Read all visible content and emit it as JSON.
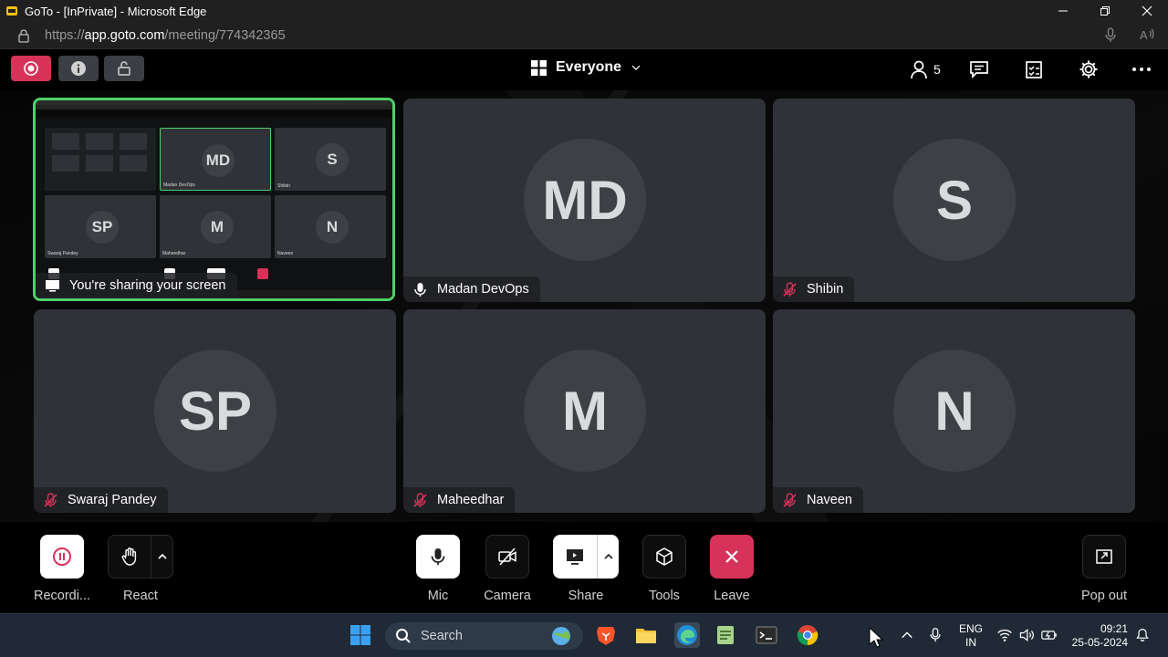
{
  "browser": {
    "title": "GoTo - [InPrivate] - Microsoft Edge",
    "url_prefix": "https://",
    "url_host": "app.goto.com",
    "url_path": "/meeting/774342365"
  },
  "toolbar": {
    "view_label": "Everyone",
    "participant_count": "5"
  },
  "tiles": [
    {
      "name": "You're sharing your screen",
      "initials": ""
    },
    {
      "name": "Madan DevOps",
      "initials": "MD",
      "mic": "on"
    },
    {
      "name": "Shibin",
      "initials": "S",
      "mic": "muted"
    },
    {
      "name": "Swaraj Pandey",
      "initials": "SP",
      "mic": "muted"
    },
    {
      "name": "Maheedhar",
      "initials": "M",
      "mic": "muted"
    },
    {
      "name": "Naveen",
      "initials": "N",
      "mic": "muted"
    }
  ],
  "controls": {
    "recording": "Recordi...",
    "react": "React",
    "mic": "Mic",
    "camera": "Camera",
    "share": "Share",
    "tools": "Tools",
    "leave": "Leave",
    "popout": "Pop out"
  },
  "taskbar": {
    "search_placeholder": "Search",
    "lang_top": "ENG",
    "lang_bottom": "IN",
    "time": "09:21",
    "date": "25-05-2024"
  },
  "colors": {
    "accent_red": "#d6325a",
    "share_border": "#4fd06b",
    "tile_bg": "#2f3237"
  }
}
